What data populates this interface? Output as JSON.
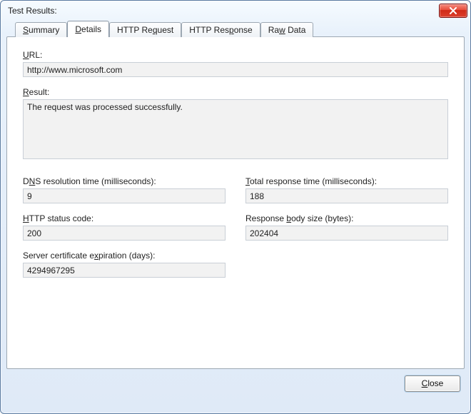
{
  "window": {
    "title": "Test Results:"
  },
  "tabs": {
    "summary": {
      "pre": "",
      "accel": "S",
      "post": "ummary"
    },
    "details": {
      "pre": "",
      "accel": "D",
      "post": "etails"
    },
    "http_request": {
      "pre": "HTTP Re",
      "accel": "q",
      "post": "uest"
    },
    "http_response": {
      "pre": "HTTP Res",
      "accel": "p",
      "post": "onse"
    },
    "raw_data": {
      "pre": "Ra",
      "accel": "w",
      "post": " Data"
    }
  },
  "details": {
    "url": {
      "label": {
        "pre": "",
        "accel": "U",
        "post": "RL:"
      },
      "value": "http://www.microsoft.com"
    },
    "result": {
      "label": {
        "pre": "",
        "accel": "R",
        "post": "esult:"
      },
      "value": "The request was processed successfully."
    },
    "dns": {
      "label": {
        "pre": "D",
        "accel": "N",
        "post": "S resolution time (milliseconds):"
      },
      "value": "9"
    },
    "total": {
      "label": {
        "pre": "",
        "accel": "T",
        "post": "otal response time (milliseconds):"
      },
      "value": "188"
    },
    "status": {
      "label": {
        "pre": "",
        "accel": "H",
        "post": "TTP status code:"
      },
      "value": "200"
    },
    "bodysize": {
      "label": {
        "pre": "Response ",
        "accel": "b",
        "post": "ody size (bytes):"
      },
      "value": "202404"
    },
    "certexp": {
      "label": {
        "pre": "Server certificate e",
        "accel": "x",
        "post": "piration (days):"
      },
      "value": "4294967295"
    }
  },
  "buttons": {
    "close": {
      "pre": "",
      "accel": "C",
      "post": "lose"
    }
  }
}
